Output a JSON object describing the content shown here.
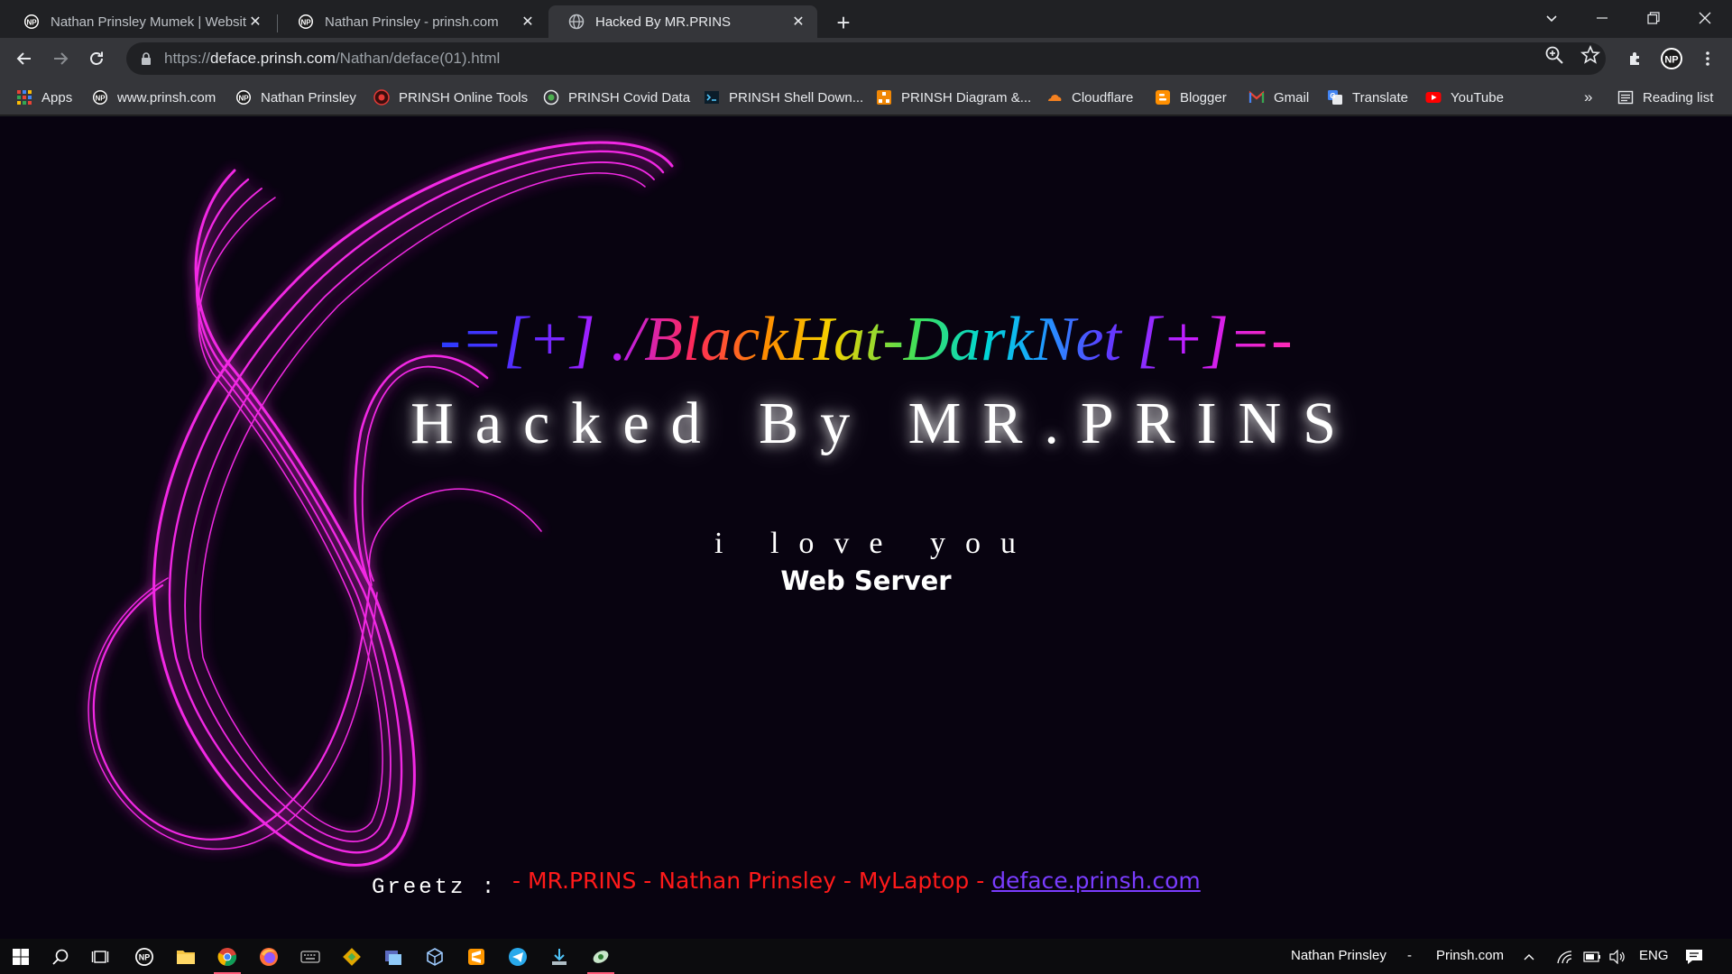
{
  "browser": {
    "tabs": [
      {
        "title": "Nathan Prinsley Mumek | Websit",
        "favicon": "np-logo-icon",
        "active": false
      },
      {
        "title": "Nathan Prinsley - prinsh.com",
        "favicon": "np-logo-icon",
        "active": false
      },
      {
        "title": "Hacked By MR.PRINS",
        "favicon": "globe-icon",
        "active": true
      }
    ],
    "url": {
      "scheme": "https://",
      "host": "deface.prinsh.com",
      "path": "/Nathan/deface(01).html"
    },
    "bookmarks": [
      {
        "label": "Apps",
        "icon": "apps-grid-icon"
      },
      {
        "label": "www.prinsh.com",
        "icon": "np-logo-icon"
      },
      {
        "label": "Nathan Prinsley",
        "icon": "np-logo-icon"
      },
      {
        "label": "PRINSH Online Tools",
        "icon": "prinsh-tools-icon"
      },
      {
        "label": "PRINSH Covid Data",
        "icon": "covid-icon"
      },
      {
        "label": "PRINSH Shell Down...",
        "icon": "shell-icon"
      },
      {
        "label": "PRINSH Diagram &...",
        "icon": "diagram-icon"
      },
      {
        "label": "Cloudflare",
        "icon": "cloudflare-icon"
      },
      {
        "label": "Blogger",
        "icon": "blogger-icon"
      },
      {
        "label": "Gmail",
        "icon": "gmail-icon"
      },
      {
        "label": "Translate",
        "icon": "translate-icon"
      },
      {
        "label": "YouTube",
        "icon": "youtube-icon"
      }
    ],
    "more_bookmarks": "»",
    "reading_list": "Reading list"
  },
  "page": {
    "banner": "-=[+] ./BlackHat-DarkNet [+]=-",
    "headline": "Hacked By MR.PRINS",
    "love": "i love you",
    "subline": "Web Server",
    "greetz_label": "Greetz :",
    "greetz_names": "- MR.PRINS - Nathan Prinsley - MyLaptop - ",
    "greetz_link": "deface.prinsh.com",
    "colors": {
      "background": "#080310",
      "swirl": "#ff2cf0",
      "greetz": "#ff1a1a",
      "link": "#7a3cff"
    }
  },
  "taskbar": {
    "apps": [
      "windows-start-icon",
      "search-icon",
      "task-view-icon",
      "np-app-icon",
      "file-explorer-icon",
      "chrome-icon",
      "firefox-icon",
      "keyboard-icon",
      "git-icon",
      "app-blue-icon",
      "virtualbox-icon",
      "sublime-icon",
      "telegram-icon",
      "download-app-icon",
      "scanner-app-icon"
    ],
    "tray_user": "Nathan Prinsley",
    "tray_sep": "-",
    "tray_site": "Prinsh.com",
    "language": "ENG"
  }
}
